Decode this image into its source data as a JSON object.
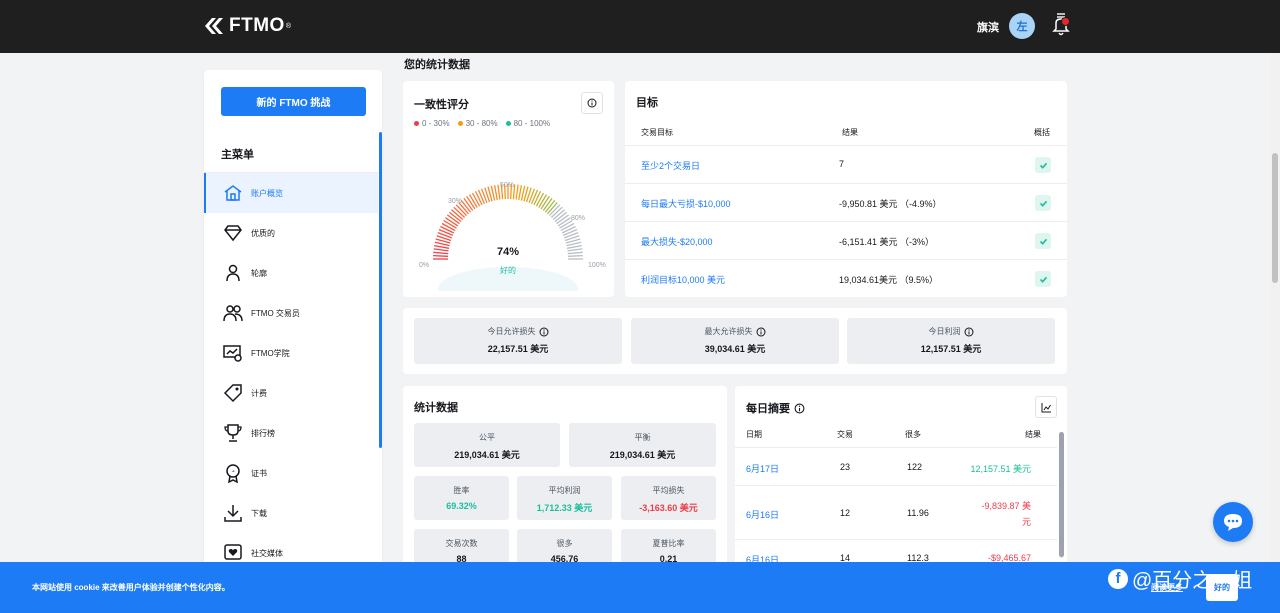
{
  "header": {
    "brand": "FTMO",
    "brand_mark": "®",
    "user_name": "旗滨",
    "avatar_letter": "左"
  },
  "sidebar": {
    "new_challenge": "新的 FTMO 挑战",
    "menu_title": "主菜单",
    "items": [
      {
        "label": "账户概览",
        "icon": "home-icon",
        "active": true
      },
      {
        "label": "优质的",
        "icon": "diamond-icon"
      },
      {
        "label": "轮廓",
        "icon": "person-icon"
      },
      {
        "label": "FTMO 交易员",
        "icon": "users-icon"
      },
      {
        "label": "FTMO学院",
        "icon": "academy-icon"
      },
      {
        "label": "计费",
        "icon": "tag-icon"
      },
      {
        "label": "排行榜",
        "icon": "trophy-icon"
      },
      {
        "label": "证书",
        "icon": "certificate-icon"
      },
      {
        "label": "下载",
        "icon": "download-icon"
      },
      {
        "label": "社交媒体",
        "icon": "heart-icon"
      }
    ]
  },
  "main": {
    "title": "您的统计数据"
  },
  "consistency": {
    "title": "一致性评分",
    "legend": [
      {
        "label": "0 - 30%",
        "color": "#ef3b4a"
      },
      {
        "label": "30 - 80%",
        "color": "#f39c12"
      },
      {
        "label": "80 - 100%",
        "color": "#1bbf9b"
      }
    ],
    "gauge_labels": {
      "l0": "0%",
      "l30": "30%",
      "l50": "50%",
      "l80": "80%",
      "l100": "100%"
    },
    "score": "74%",
    "score_value": 74,
    "score_text": "好的"
  },
  "goals": {
    "title": "目标",
    "headers": {
      "goal": "交易目标",
      "result": "结果",
      "summary": "概括"
    },
    "rows": [
      {
        "goal": "至少2个交易日",
        "result": "7"
      },
      {
        "goal": "每日最大亏损-$10,000",
        "result": "-9,950.81 美元 （-4.9%）"
      },
      {
        "goal": "最大损失-$20,000",
        "result": "-6,151.41 美元 （-3%）"
      },
      {
        "goal": "利润目标10,000 美元",
        "result": "19,034.61美元 （9.5%）"
      }
    ]
  },
  "summary": [
    {
      "label": "今日允许损失",
      "value": "22,157.51 美元"
    },
    {
      "label": "最大允许损失",
      "value": "39,034.61 美元"
    },
    {
      "label": "今日利润",
      "value": "12,157.51 美元"
    }
  ],
  "stats": {
    "title": "统计数据",
    "equity_label": "公平",
    "equity_value": "219,034.61 美元",
    "balance_label": "平衡",
    "balance_value": "219,034.61 美元",
    "winrate_label": "胜率",
    "winrate_value": "69.32%",
    "avgprofit_label": "平均利润",
    "avgprofit_value": "1,712.33 美元",
    "avgloss_label": "平均损失",
    "avgloss_value": "-3,163.60 美元",
    "trades_label": "交易次数",
    "trades_value": "88",
    "lots_label": "很多",
    "lots_value": "456.76",
    "sharpe_label": "夏普比率",
    "sharpe_value": "0.21"
  },
  "daily": {
    "title": "每日摘要",
    "headers": {
      "date": "日期",
      "trades": "交易",
      "lots": "很多",
      "result": "结果"
    },
    "rows": [
      {
        "date": "6月17日",
        "trades": "23",
        "lots": "122",
        "result": "12,157.51 美元"
      },
      {
        "date": "6月16日",
        "trades": "12",
        "lots": "11.96",
        "result_l1": "-9,839.87 美",
        "result_l2": "元"
      },
      {
        "date": "6月16日",
        "trades": "14",
        "lots": "112.3",
        "result": "-$9,465.67"
      }
    ]
  },
  "cookie": {
    "text": "本网站使用 cookie 来改善用户体验并创建个性化内容。",
    "more": "阅读更多",
    "ok": "好的"
  },
  "watermark": {
    "text": "@百分之一姐"
  }
}
